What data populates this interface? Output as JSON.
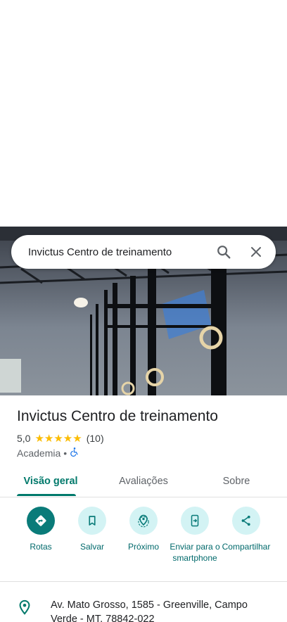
{
  "search": {
    "query": "Invictus Centro de treinamento"
  },
  "place": {
    "name": "Invictus Centro de treinamento",
    "rating": "5,0",
    "stars": "★★★★★",
    "review_count": "(10)",
    "category": "Academia",
    "separator": "•"
  },
  "tabs": [
    {
      "label": "Visão geral",
      "active": true
    },
    {
      "label": "Avaliações",
      "active": false
    },
    {
      "label": "Sobre",
      "active": false
    }
  ],
  "actions": [
    {
      "label": "Rotas",
      "icon": "directions-icon"
    },
    {
      "label": "Salvar",
      "icon": "bookmark-icon"
    },
    {
      "label": "Próximo",
      "icon": "nearby-icon"
    },
    {
      "label": "Enviar para o smartphone",
      "icon": "send-to-phone-icon"
    },
    {
      "label": "Compartilhar",
      "icon": "share-icon"
    }
  ],
  "address": {
    "text": "Av. Mato Grosso, 1585 - Greenville, Campo Verde - MT, 78842-022"
  },
  "colors": {
    "accent": "#00796b",
    "action_bg": "#d3f3f4",
    "primary_action": "#0a7b79",
    "star": "#fbbc04"
  }
}
